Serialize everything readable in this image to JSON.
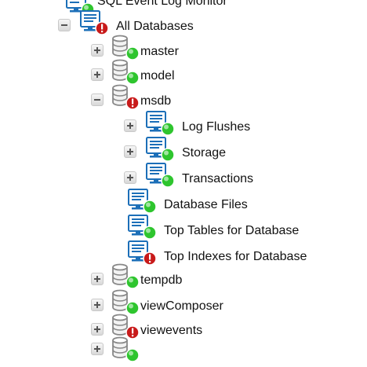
{
  "colors": {
    "ok": "#2ec52e",
    "error": "#c81a1a",
    "monitor": "#1c6fb8",
    "db": "#888888"
  },
  "tree": {
    "root": {
      "label": "SQL Event Log Monitor",
      "icon": "monitor-icon",
      "status": "ok"
    },
    "all_databases": {
      "label": "All Databases",
      "icon": "monitor-icon",
      "status": "error",
      "expanded": true
    },
    "databases": [
      {
        "label": "master",
        "icon": "database-icon",
        "status": "ok",
        "expanded": false
      },
      {
        "label": "model",
        "icon": "database-icon",
        "status": "ok",
        "expanded": false
      },
      {
        "label": "msdb",
        "icon": "database-icon",
        "status": "error",
        "expanded": true,
        "children": [
          {
            "label": "Log Flushes",
            "icon": "monitor-icon",
            "status": "ok",
            "expandable": true
          },
          {
            "label": "Storage",
            "icon": "monitor-icon",
            "status": "ok",
            "expandable": true
          },
          {
            "label": "Transactions",
            "icon": "monitor-icon",
            "status": "ok",
            "expandable": true
          },
          {
            "label": "Database Files",
            "icon": "monitor-icon",
            "status": "ok",
            "expandable": false
          },
          {
            "label": "Top Tables for Database",
            "icon": "monitor-icon",
            "status": "ok",
            "expandable": false
          },
          {
            "label": "Top Indexes for Database",
            "icon": "monitor-icon",
            "status": "error",
            "expandable": false
          }
        ]
      },
      {
        "label": "tempdb",
        "icon": "database-icon",
        "status": "ok",
        "expanded": false
      },
      {
        "label": "viewComposer",
        "icon": "database-icon",
        "status": "ok",
        "expanded": false
      },
      {
        "label": "viewevents",
        "icon": "database-icon",
        "status": "error",
        "expanded": false
      }
    ]
  }
}
